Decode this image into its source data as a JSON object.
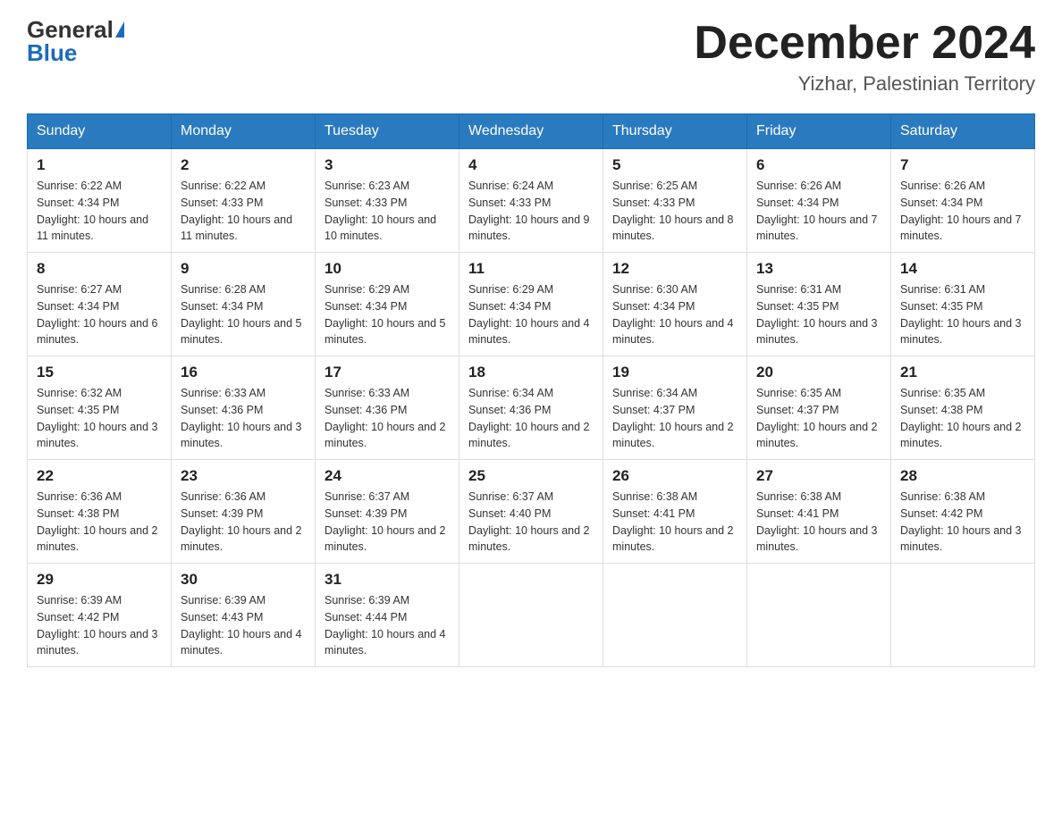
{
  "header": {
    "logo_general": "General",
    "logo_blue": "Blue",
    "month_title": "December 2024",
    "location": "Yizhar, Palestinian Territory"
  },
  "days_of_week": [
    "Sunday",
    "Monday",
    "Tuesday",
    "Wednesday",
    "Thursday",
    "Friday",
    "Saturday"
  ],
  "weeks": [
    [
      {
        "day": "1",
        "sunrise": "6:22 AM",
        "sunset": "4:34 PM",
        "daylight": "10 hours and 11 minutes."
      },
      {
        "day": "2",
        "sunrise": "6:22 AM",
        "sunset": "4:33 PM",
        "daylight": "10 hours and 11 minutes."
      },
      {
        "day": "3",
        "sunrise": "6:23 AM",
        "sunset": "4:33 PM",
        "daylight": "10 hours and 10 minutes."
      },
      {
        "day": "4",
        "sunrise": "6:24 AM",
        "sunset": "4:33 PM",
        "daylight": "10 hours and 9 minutes."
      },
      {
        "day": "5",
        "sunrise": "6:25 AM",
        "sunset": "4:33 PM",
        "daylight": "10 hours and 8 minutes."
      },
      {
        "day": "6",
        "sunrise": "6:26 AM",
        "sunset": "4:34 PM",
        "daylight": "10 hours and 7 minutes."
      },
      {
        "day": "7",
        "sunrise": "6:26 AM",
        "sunset": "4:34 PM",
        "daylight": "10 hours and 7 minutes."
      }
    ],
    [
      {
        "day": "8",
        "sunrise": "6:27 AM",
        "sunset": "4:34 PM",
        "daylight": "10 hours and 6 minutes."
      },
      {
        "day": "9",
        "sunrise": "6:28 AM",
        "sunset": "4:34 PM",
        "daylight": "10 hours and 5 minutes."
      },
      {
        "day": "10",
        "sunrise": "6:29 AM",
        "sunset": "4:34 PM",
        "daylight": "10 hours and 5 minutes."
      },
      {
        "day": "11",
        "sunrise": "6:29 AM",
        "sunset": "4:34 PM",
        "daylight": "10 hours and 4 minutes."
      },
      {
        "day": "12",
        "sunrise": "6:30 AM",
        "sunset": "4:34 PM",
        "daylight": "10 hours and 4 minutes."
      },
      {
        "day": "13",
        "sunrise": "6:31 AM",
        "sunset": "4:35 PM",
        "daylight": "10 hours and 3 minutes."
      },
      {
        "day": "14",
        "sunrise": "6:31 AM",
        "sunset": "4:35 PM",
        "daylight": "10 hours and 3 minutes."
      }
    ],
    [
      {
        "day": "15",
        "sunrise": "6:32 AM",
        "sunset": "4:35 PM",
        "daylight": "10 hours and 3 minutes."
      },
      {
        "day": "16",
        "sunrise": "6:33 AM",
        "sunset": "4:36 PM",
        "daylight": "10 hours and 3 minutes."
      },
      {
        "day": "17",
        "sunrise": "6:33 AM",
        "sunset": "4:36 PM",
        "daylight": "10 hours and 2 minutes."
      },
      {
        "day": "18",
        "sunrise": "6:34 AM",
        "sunset": "4:36 PM",
        "daylight": "10 hours and 2 minutes."
      },
      {
        "day": "19",
        "sunrise": "6:34 AM",
        "sunset": "4:37 PM",
        "daylight": "10 hours and 2 minutes."
      },
      {
        "day": "20",
        "sunrise": "6:35 AM",
        "sunset": "4:37 PM",
        "daylight": "10 hours and 2 minutes."
      },
      {
        "day": "21",
        "sunrise": "6:35 AM",
        "sunset": "4:38 PM",
        "daylight": "10 hours and 2 minutes."
      }
    ],
    [
      {
        "day": "22",
        "sunrise": "6:36 AM",
        "sunset": "4:38 PM",
        "daylight": "10 hours and 2 minutes."
      },
      {
        "day": "23",
        "sunrise": "6:36 AM",
        "sunset": "4:39 PM",
        "daylight": "10 hours and 2 minutes."
      },
      {
        "day": "24",
        "sunrise": "6:37 AM",
        "sunset": "4:39 PM",
        "daylight": "10 hours and 2 minutes."
      },
      {
        "day": "25",
        "sunrise": "6:37 AM",
        "sunset": "4:40 PM",
        "daylight": "10 hours and 2 minutes."
      },
      {
        "day": "26",
        "sunrise": "6:38 AM",
        "sunset": "4:41 PM",
        "daylight": "10 hours and 2 minutes."
      },
      {
        "day": "27",
        "sunrise": "6:38 AM",
        "sunset": "4:41 PM",
        "daylight": "10 hours and 3 minutes."
      },
      {
        "day": "28",
        "sunrise": "6:38 AM",
        "sunset": "4:42 PM",
        "daylight": "10 hours and 3 minutes."
      }
    ],
    [
      {
        "day": "29",
        "sunrise": "6:39 AM",
        "sunset": "4:42 PM",
        "daylight": "10 hours and 3 minutes."
      },
      {
        "day": "30",
        "sunrise": "6:39 AM",
        "sunset": "4:43 PM",
        "daylight": "10 hours and 4 minutes."
      },
      {
        "day": "31",
        "sunrise": "6:39 AM",
        "sunset": "4:44 PM",
        "daylight": "10 hours and 4 minutes."
      },
      null,
      null,
      null,
      null
    ]
  ]
}
